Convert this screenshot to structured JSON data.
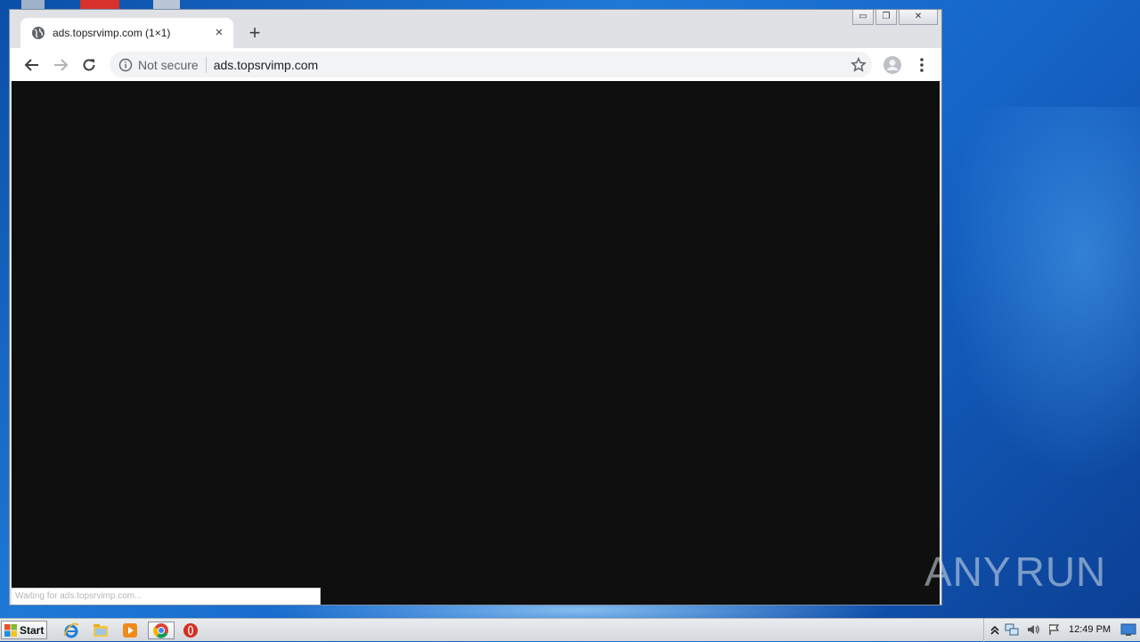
{
  "browser": {
    "tab": {
      "title": "ads.topsrvimp.com (1×1)",
      "close_glyph": "×",
      "icon": "globe-icon"
    },
    "new_tab_glyph": "+",
    "window_controls": {
      "minimize": "▭",
      "restore": "❐",
      "close": "✕"
    },
    "nav": {
      "back": "arrow-left-icon",
      "forward": "arrow-right-icon",
      "reload": "reload-icon"
    },
    "omnibox": {
      "security_label": "Not secure",
      "url": "ads.topsrvimp.com",
      "info_icon": "info-icon",
      "bookmark_icon": "star-icon"
    },
    "profile_icon": "person-icon",
    "menu_icon": "three-dots-icon",
    "content_background": "#0f0f10",
    "status_text": "Waiting for ads.topsrvimp.com..."
  },
  "watermark": {
    "left": "ANY",
    "right": "RUN"
  },
  "taskbar": {
    "start_label": "Start",
    "pinned": [
      "internet-explorer-icon",
      "file-explorer-icon",
      "media-player-icon",
      "chrome-icon",
      "opera-icon"
    ],
    "active": "chrome-icon",
    "tray": [
      "show-hidden-icons-icon",
      "network-icon",
      "volume-icon",
      "action-center-flag-icon"
    ],
    "clock": "12:49 PM"
  },
  "colors": {
    "desktop": "#1565c8",
    "accent_red": "#d62d20",
    "chrome_tab_strip": "#dfe1e5"
  }
}
